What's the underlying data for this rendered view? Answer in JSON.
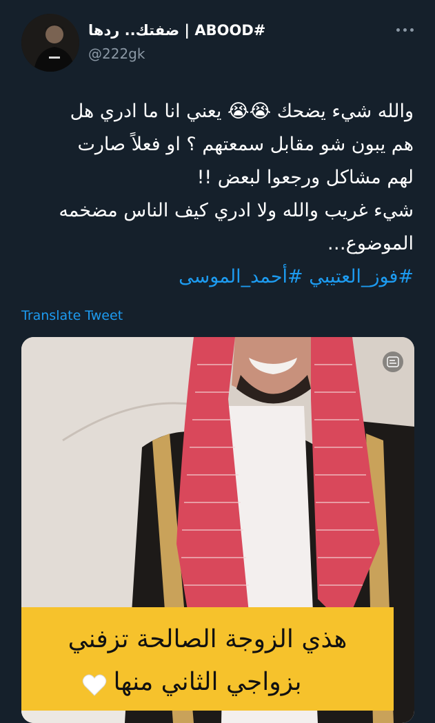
{
  "tweet": {
    "author_name": "ضفتك.. ردها | ABOOD#",
    "author_handle": "@222gk",
    "text_lines": [
      "والله شيء يضحك 😭😭 يعني انا ما ادري هل",
      "هم يبون شو مقابل سمعتهم ؟ او فعلاً صارت",
      "لهم مشاكل ورجعوا لبعض !!",
      "شيء غريب والله ولا ادري كيف الناس مضخمه",
      "الموضوع…"
    ],
    "hashtags": [
      "#فوز_العتيبي",
      "#أحمد_الموسى"
    ],
    "translate_label": "Translate Tweet"
  },
  "media": {
    "caption_line1": "هذي الزوجة الصالحة تزفني",
    "caption_line2": "بزواجي الثاني منها"
  },
  "icons": {
    "more": "more-horizontal-icon",
    "alt": "alt-text-icon",
    "heart": "white-heart-icon"
  },
  "colors": {
    "background": "#15202b",
    "link": "#1d9bf0",
    "secondary_text": "#8b98a5",
    "caption_bg": "#f6c22c"
  }
}
